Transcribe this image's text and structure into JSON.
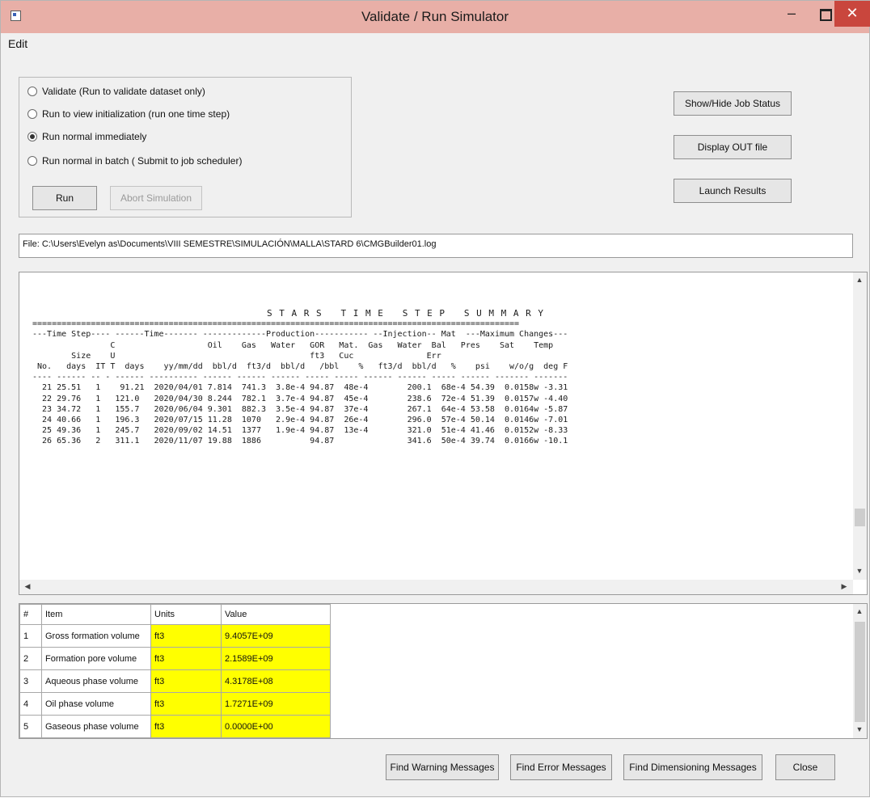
{
  "window": {
    "title": "Validate / Run Simulator",
    "min_label": "–",
    "close_label": "✕"
  },
  "menu": {
    "edit": "Edit"
  },
  "run_options": {
    "validate": "Validate (Run to validate dataset only)",
    "init": "Run to view initialization (run one time step)",
    "normal": "Run normal immediately",
    "batch": "Run normal in batch ( Submit to job scheduler)",
    "selected": "normal"
  },
  "buttons": {
    "run": "Run",
    "abort": "Abort Simulation",
    "job_status": "Show/Hide Job Status",
    "display_out": "Display OUT file",
    "launch": "Launch Results",
    "warnings": "Find Warning Messages",
    "errors": "Find Error Messages",
    "dimensioning": "Find Dimensioning Messages",
    "close": "Close"
  },
  "file_path": "File: C:\\Users\\Evelyn as\\Documents\\VIII SEMESTRE\\SIMULACIÓN\\MALLA\\STARD 6\\CMGBuilder01.log",
  "log": {
    "title": "S T A R S   T I M E   S T E P   S U M M A R Y",
    "divider": "====================================================================================================",
    "header1": "---Time Step---- ------Time------- -------------Production----------- --Injection-- Mat  ---Maximum Changes---",
    "header2": "                C                   Oil    Gas   Water   GOR   Mat.  Gas   Water  Bal   Pres    Sat    Temp",
    "header3": "        Size    U                                        ft3   Cuc               Err",
    "header4": " No.   days  IT T  days    yy/mm/dd  bbl/d  ft3/d  bbl/d   /bbl    %   ft3/d  bbl/d   %    psi    w/o/g  deg F",
    "header5": "---- ------ -- - ------ ---------- ------ ------ ------ ----- ----- ------ ------ ----- ------ ------- -------",
    "rows": [
      "  21 25.51   1    91.21  2020/04/01 7.814  741.3  3.8e-4 94.87  48e-4        200.1  68e-4 54.39  0.0158w -3.31",
      "  22 29.76   1   121.0   2020/04/30 8.244  782.1  3.7e-4 94.87  45e-4        238.6  72e-4 51.39  0.0157w -4.40",
      "  23 34.72   1   155.7   2020/06/04 9.301  882.3  3.5e-4 94.87  37e-4        267.1  64e-4 53.58  0.0164w -5.87",
      "  24 40.66   1   196.3   2020/07/15 11.28  1070   2.9e-4 94.87  26e-4        296.0  57e-4 50.14  0.0146w -7.01",
      "  25 49.36   1   245.7   2020/09/02 14.51  1377   1.9e-4 94.87  13e-4        321.0  51e-4 41.46  0.0152w -8.33",
      "  26 65.36   2   311.1   2020/11/07 19.88  1886          94.87               341.6  50e-4 39.74  0.0166w -10.1"
    ]
  },
  "grid": {
    "headers": {
      "num": "#",
      "item": "Item",
      "units": "Units",
      "value": "Value"
    },
    "rows": [
      {
        "num": "1",
        "item": "Gross formation volume",
        "units": "ft3",
        "value": "9.4057E+09"
      },
      {
        "num": "2",
        "item": "Formation pore volume",
        "units": "ft3",
        "value": "2.1589E+09"
      },
      {
        "num": "3",
        "item": "Aqueous phase volume",
        "units": "ft3",
        "value": "4.3178E+08"
      },
      {
        "num": "4",
        "item": "Oil phase volume",
        "units": "ft3",
        "value": "1.7271E+09"
      },
      {
        "num": "5",
        "item": "Gaseous phase volume",
        "units": "ft3",
        "value": "0.0000E+00"
      }
    ]
  },
  "scroll": {
    "up": "▲",
    "down": "▼",
    "left": "◀",
    "right": "▶"
  }
}
